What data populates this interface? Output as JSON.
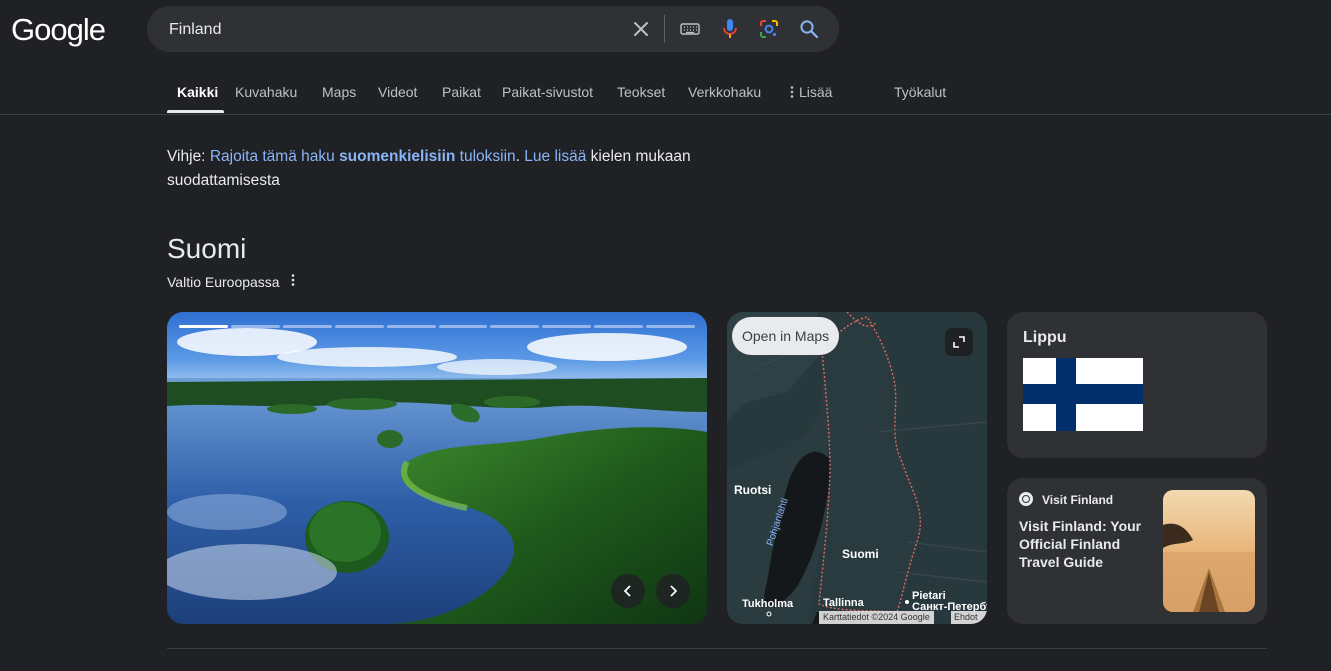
{
  "logo": "Google",
  "search": {
    "query": "Finland"
  },
  "tabs": [
    {
      "label": "Kaikki",
      "active": true
    },
    {
      "label": "Kuvahaku"
    },
    {
      "label": "Maps"
    },
    {
      "label": "Videot"
    },
    {
      "label": "Paikat"
    },
    {
      "label": "Paikat-sivustot"
    },
    {
      "label": "Teokset"
    },
    {
      "label": "Verkkohaku"
    },
    {
      "label": "Lisää"
    }
  ],
  "tools_label": "Työkalut",
  "hint": {
    "prefix": "Vihje: ",
    "link1": "Rajoita tämä haku ",
    "bold": "suomenkielisiin",
    "link2": " tuloksiin",
    "dot": ". ",
    "link3": "Lue lisää",
    "suffix": " kielen mukaan suodattamisesta"
  },
  "knowledge_panel": {
    "title": "Suomi",
    "subtitle": "Valtio Euroopassa"
  },
  "map": {
    "open_label": "Open in Maps",
    "labels": {
      "sweden": "Ruotsi",
      "finland": "Suomi",
      "stockholm": "Tukholma",
      "tallinn": "Tallinna",
      "petersburg": "Pietari",
      "petersburg_ru": "Санкт-Петербург",
      "gulf": "Pohjanlahti"
    },
    "credit": "Karttatiedot ©2024 Google",
    "terms": "Ehdot"
  },
  "flag_card": {
    "title": "Lippu"
  },
  "visit_card": {
    "source": "Visit Finland",
    "title": "Visit Finland: Your Official Finland Travel Guide"
  },
  "colors": {
    "background": "#202124",
    "link": "#8ab4f8",
    "flag_blue": "#002f6c",
    "card": "#303134"
  }
}
